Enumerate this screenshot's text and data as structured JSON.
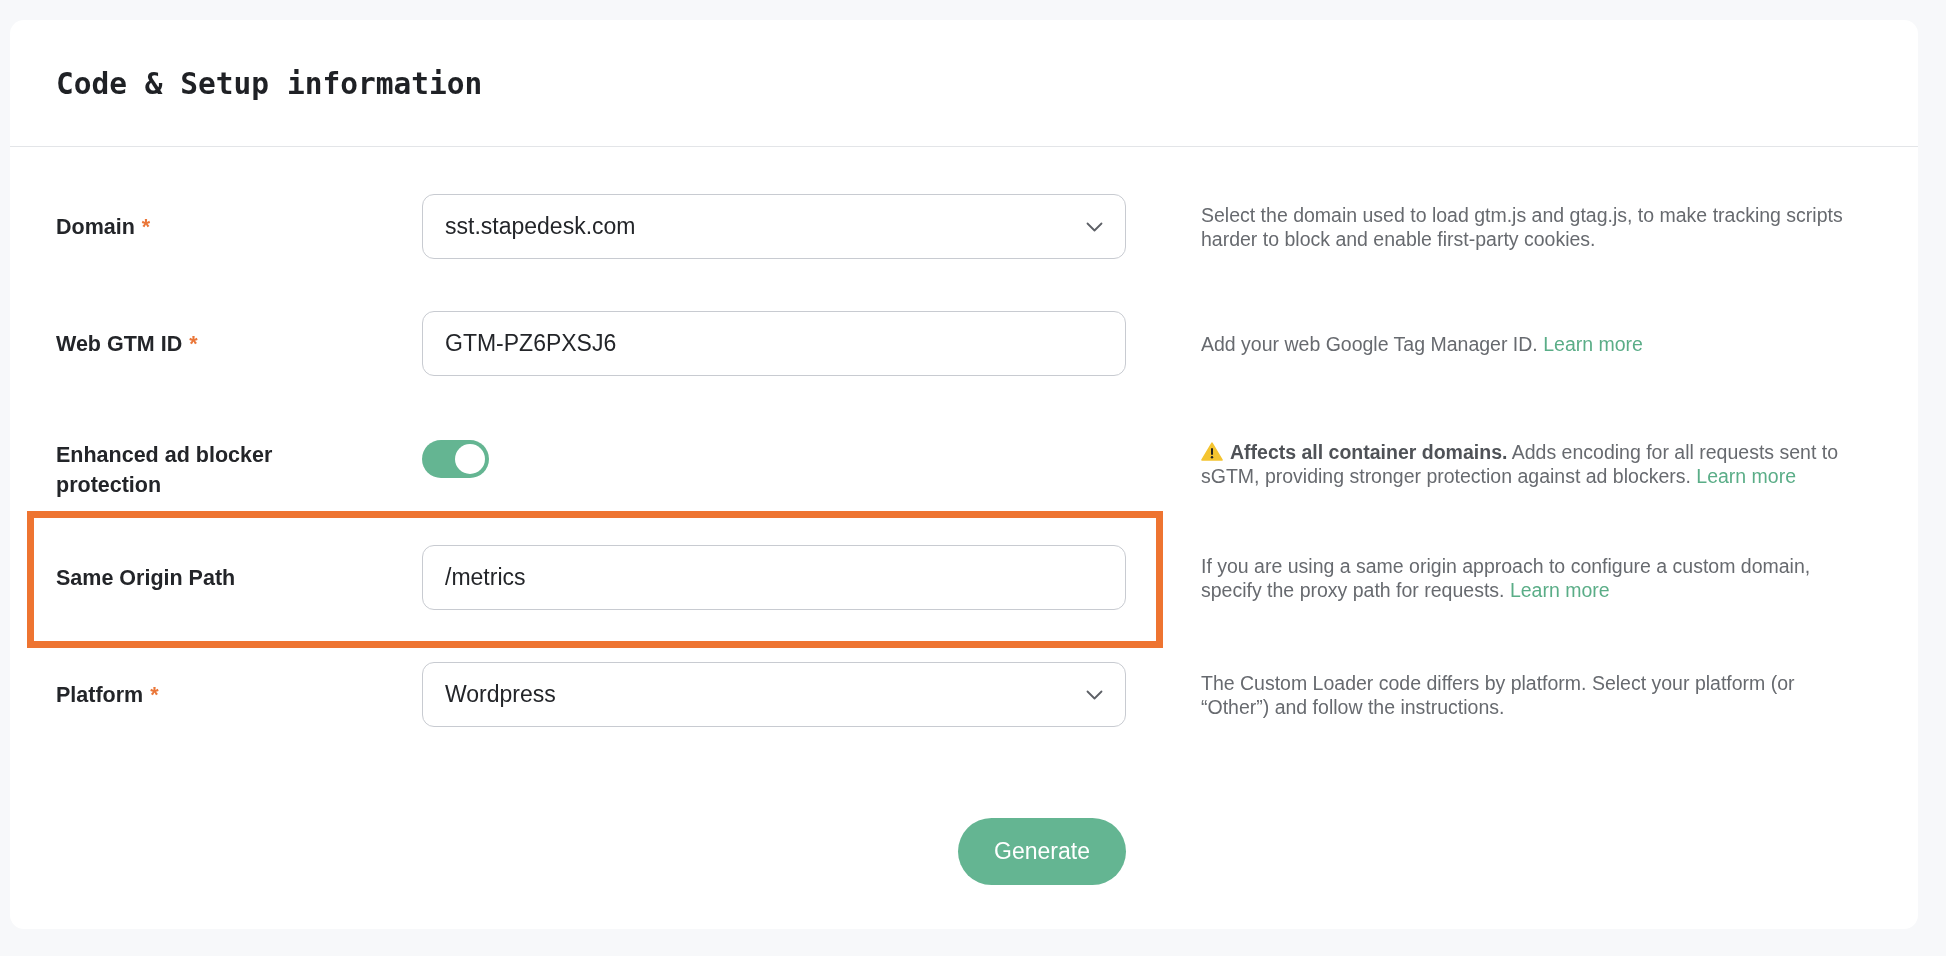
{
  "card": {
    "title": "Code & Setup information"
  },
  "rows": [
    {
      "label": "Domain",
      "required_mark": "*",
      "highlighted": false,
      "control": {
        "kind": "select",
        "value": "sst.stapedesk.com"
      },
      "description": {
        "warning": false,
        "text": "Select the domain used to load gtm.js and gtag.js, to make tracking scripts harder to block and enable first-party cookies."
      }
    },
    {
      "label": "Web GTM ID",
      "required_mark": "*",
      "highlighted": false,
      "control": {
        "kind": "text",
        "value": "GTM-PZ6PXSJ6"
      },
      "description": {
        "warning": false,
        "text": "Add your web Google Tag Manager ID.",
        "link": "Learn more"
      }
    },
    {
      "label": "Enhanced ad blocker protection",
      "highlighted": false,
      "control": {
        "kind": "toggle",
        "on": true
      },
      "description": {
        "warning": true,
        "text": "**Affects all container domains.** Adds encoding for all requests sent to sGTM, providing stronger protection against ad blockers.",
        "link": "Learn more"
      }
    },
    {
      "label": "Same Origin Path",
      "highlighted": true,
      "control": {
        "kind": "text",
        "value": "/metrics"
      },
      "description": {
        "warning": false,
        "text": "If you are using a same origin approach to configure a custom domain, specify the proxy path for requests.",
        "link": "Learn more"
      }
    },
    {
      "label": "Platform",
      "required_mark": "*",
      "highlighted": false,
      "control": {
        "kind": "select",
        "value": "Wordpress"
      },
      "description": {
        "warning": false,
        "text": "The Custom Loader code differs by platform. Select your platform (or “Other”) and follow the instructions."
      }
    }
  ],
  "submit_button": "Generate"
}
